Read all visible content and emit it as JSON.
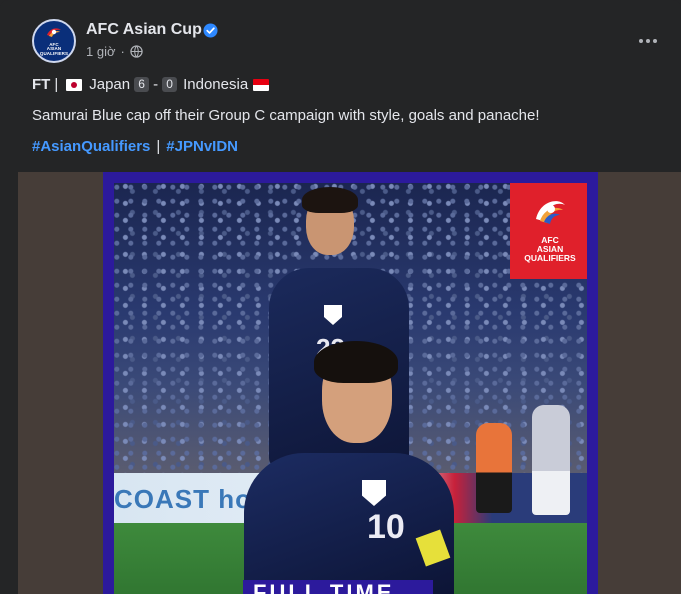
{
  "post": {
    "page_name": "AFC Asian Cup",
    "avatar_text_line1": "AFC",
    "avatar_text_line2": "ASIAN",
    "avatar_text_line3": "QUALIFIERS",
    "time": "1 giờ",
    "separator": "·",
    "score_line": {
      "prefix": "FT",
      "divider": "|",
      "team_home": "Japan",
      "score_home": "6",
      "dash": "-",
      "score_away": "0",
      "team_away": "Indonesia"
    },
    "caption": "Samurai Blue cap off their Group C campaign with style, goals and panache!",
    "hashtags": [
      "#AsianQualifiers",
      "#JPNvIDN"
    ],
    "hashtag_separator": "|"
  },
  "media": {
    "badge_line1": "AFC",
    "badge_line2": "ASIAN",
    "badge_line3": "QUALIFIERS",
    "ad_text": "COAST hote",
    "back_number": "22",
    "front_number": "10",
    "banner_text": "FULL TIME"
  },
  "colors": {
    "background": "#242526",
    "text_primary": "#e4e6eb",
    "text_secondary": "#b0b3b8",
    "link": "#4599ff",
    "verified": "#2d88ff",
    "frame": "#2c1a9c",
    "badge_red": "#e0202b"
  },
  "icons": {
    "verified": "verified-badge-icon",
    "globe": "globe-icon",
    "more": "more-options-icon"
  }
}
